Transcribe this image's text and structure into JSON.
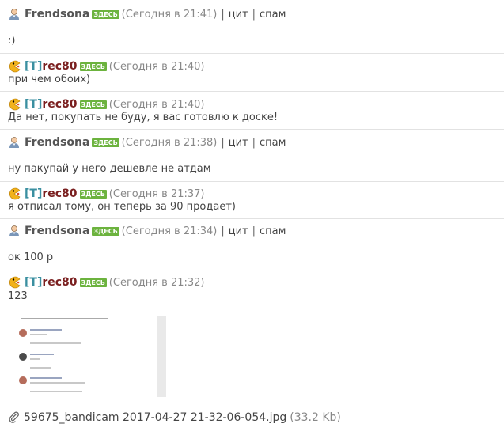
{
  "here_badge": "ЗДЕСЬ",
  "actions": {
    "quote": "цит",
    "sep": "|",
    "spam": "спам"
  },
  "posts": [
    {
      "author": "Frendsona",
      "time": "(Сегодня в 21:41)",
      "text": ":)"
    },
    {
      "author_bracket": "[T]",
      "author_name": "rec80",
      "time": "(Сегодня в 21:40)",
      "text": "при чем обоих)"
    },
    {
      "author_bracket": "[T]",
      "author_name": "rec80",
      "time": "(Сегодня в 21:40)",
      "text": "Да нет, покупать не буду, я вас готовлю к доске!"
    },
    {
      "author": "Frendsona",
      "time": "(Сегодня в 21:38)",
      "text": "ну пакупай у него дешевле не атдам"
    },
    {
      "author_bracket": "[T]",
      "author_name": "rec80",
      "time": "(Сегодня в 21:37)",
      "text": "я отписал тому, он теперь за 90 продает)"
    },
    {
      "author": "Frendsona",
      "time": "(Сегодня в 21:34)",
      "text": "ок 100 р"
    },
    {
      "author_bracket": "[T]",
      "author_name": "rec80",
      "time": "(Сегодня в 21:32)",
      "text": "123"
    }
  ],
  "attachment": {
    "divider": "------",
    "filename": "59675_bandicam 2017-04-27 21-32-06-054.jpg",
    "size": "(33.2 Kb)"
  },
  "icons": {
    "user": "user-avatar-icon",
    "pacman": "pacman-avatar-icon",
    "clip": "paperclip-icon"
  },
  "colors": {
    "here_badge": "#6cb33e",
    "bracket": "#3a8fa0",
    "nick": "#7a1f1f",
    "time": "#888888"
  }
}
